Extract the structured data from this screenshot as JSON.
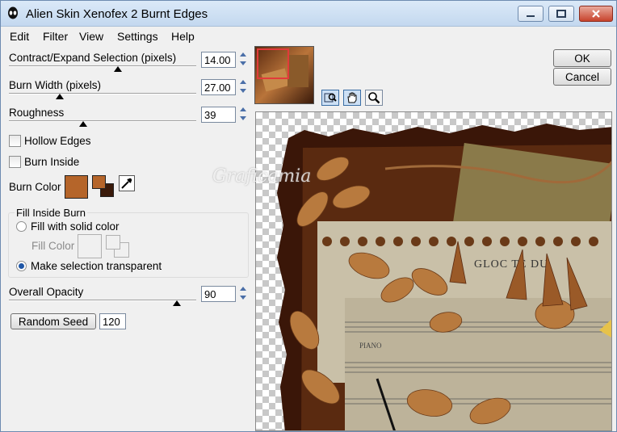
{
  "window": {
    "title": "Alien Skin Xenofex 2 Burnt Edges"
  },
  "menu": [
    "Edit",
    "Filter",
    "View",
    "Settings",
    "Help"
  ],
  "controls": {
    "contract": {
      "label": "Contract/Expand Selection (pixels)",
      "value": "14.00"
    },
    "burn_width": {
      "label": "Burn Width (pixels)",
      "value": "27.00"
    },
    "roughness": {
      "label": "Roughness",
      "value": "39"
    },
    "hollow_edges": {
      "label": "Hollow Edges",
      "checked": false
    },
    "burn_inside": {
      "label": "Burn Inside",
      "checked": false
    },
    "burn_color": {
      "label": "Burn Color",
      "color": "#b5652a",
      "front_color": "#b5652a",
      "back_color": "#3a1a0a"
    },
    "fill_group": {
      "title": "Fill Inside Burn",
      "option_solid": "Fill with solid color",
      "fill_color_label": "Fill Color",
      "option_transparent": "Make selection transparent",
      "selected": "transparent"
    },
    "opacity": {
      "label": "Overall Opacity",
      "value": "90"
    },
    "random_seed": {
      "label": "Random Seed",
      "value": "120"
    }
  },
  "buttons": {
    "ok": "OK",
    "cancel": "Cancel"
  },
  "tools": [
    "zoom-preview-icon",
    "hand-icon",
    "magnifier-icon"
  ],
  "preview": {
    "paper_text": "GLOC  TE DU",
    "music_text": "PIANO",
    "watermark": "Graficamia"
  }
}
